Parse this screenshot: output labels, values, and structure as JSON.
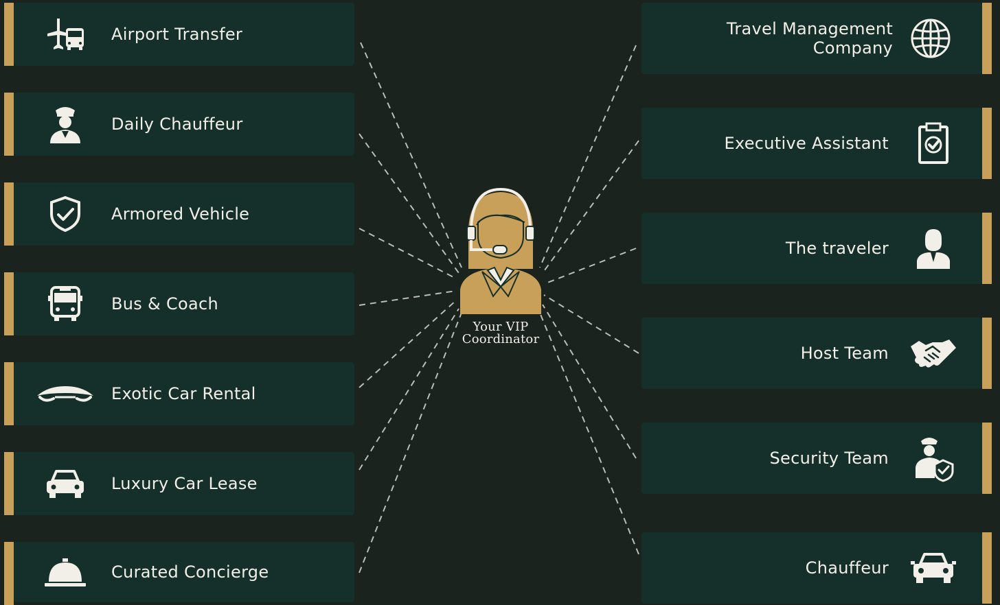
{
  "left_items": [
    {
      "label": "Airport Transfer",
      "icon": "plane-bus-icon"
    },
    {
      "label": "Daily Chauffeur",
      "icon": "chauffeur-icon"
    },
    {
      "label": "Armored Vehicle",
      "icon": "shield-check-icon"
    },
    {
      "label": "Bus & Coach",
      "icon": "bus-icon"
    },
    {
      "label": "Exotic Car Rental",
      "icon": "sports-car-icon"
    },
    {
      "label": "Luxury Car Lease",
      "icon": "car-icon"
    },
    {
      "label": "Curated Concierge",
      "icon": "service-bell-icon"
    }
  ],
  "right_items": [
    {
      "label": "Travel Management Company",
      "icon": "globe-icon"
    },
    {
      "label": "Executive Assistant",
      "icon": "clipboard-check-icon"
    },
    {
      "label": "The traveler",
      "icon": "person-icon"
    },
    {
      "label": "Host Team",
      "icon": "handshake-icon"
    },
    {
      "label": "Security Team",
      "icon": "security-guard-icon"
    },
    {
      "label": "Chauffeur",
      "icon": "car-front-icon"
    }
  ],
  "center": {
    "line1": "Your VIP",
    "line2": "Coordinator",
    "icon": "headset-agent-icon"
  },
  "colors": {
    "background": "#1a231e",
    "card": "#15302a",
    "accent": "#c9a05a",
    "text": "#f2efe8"
  }
}
